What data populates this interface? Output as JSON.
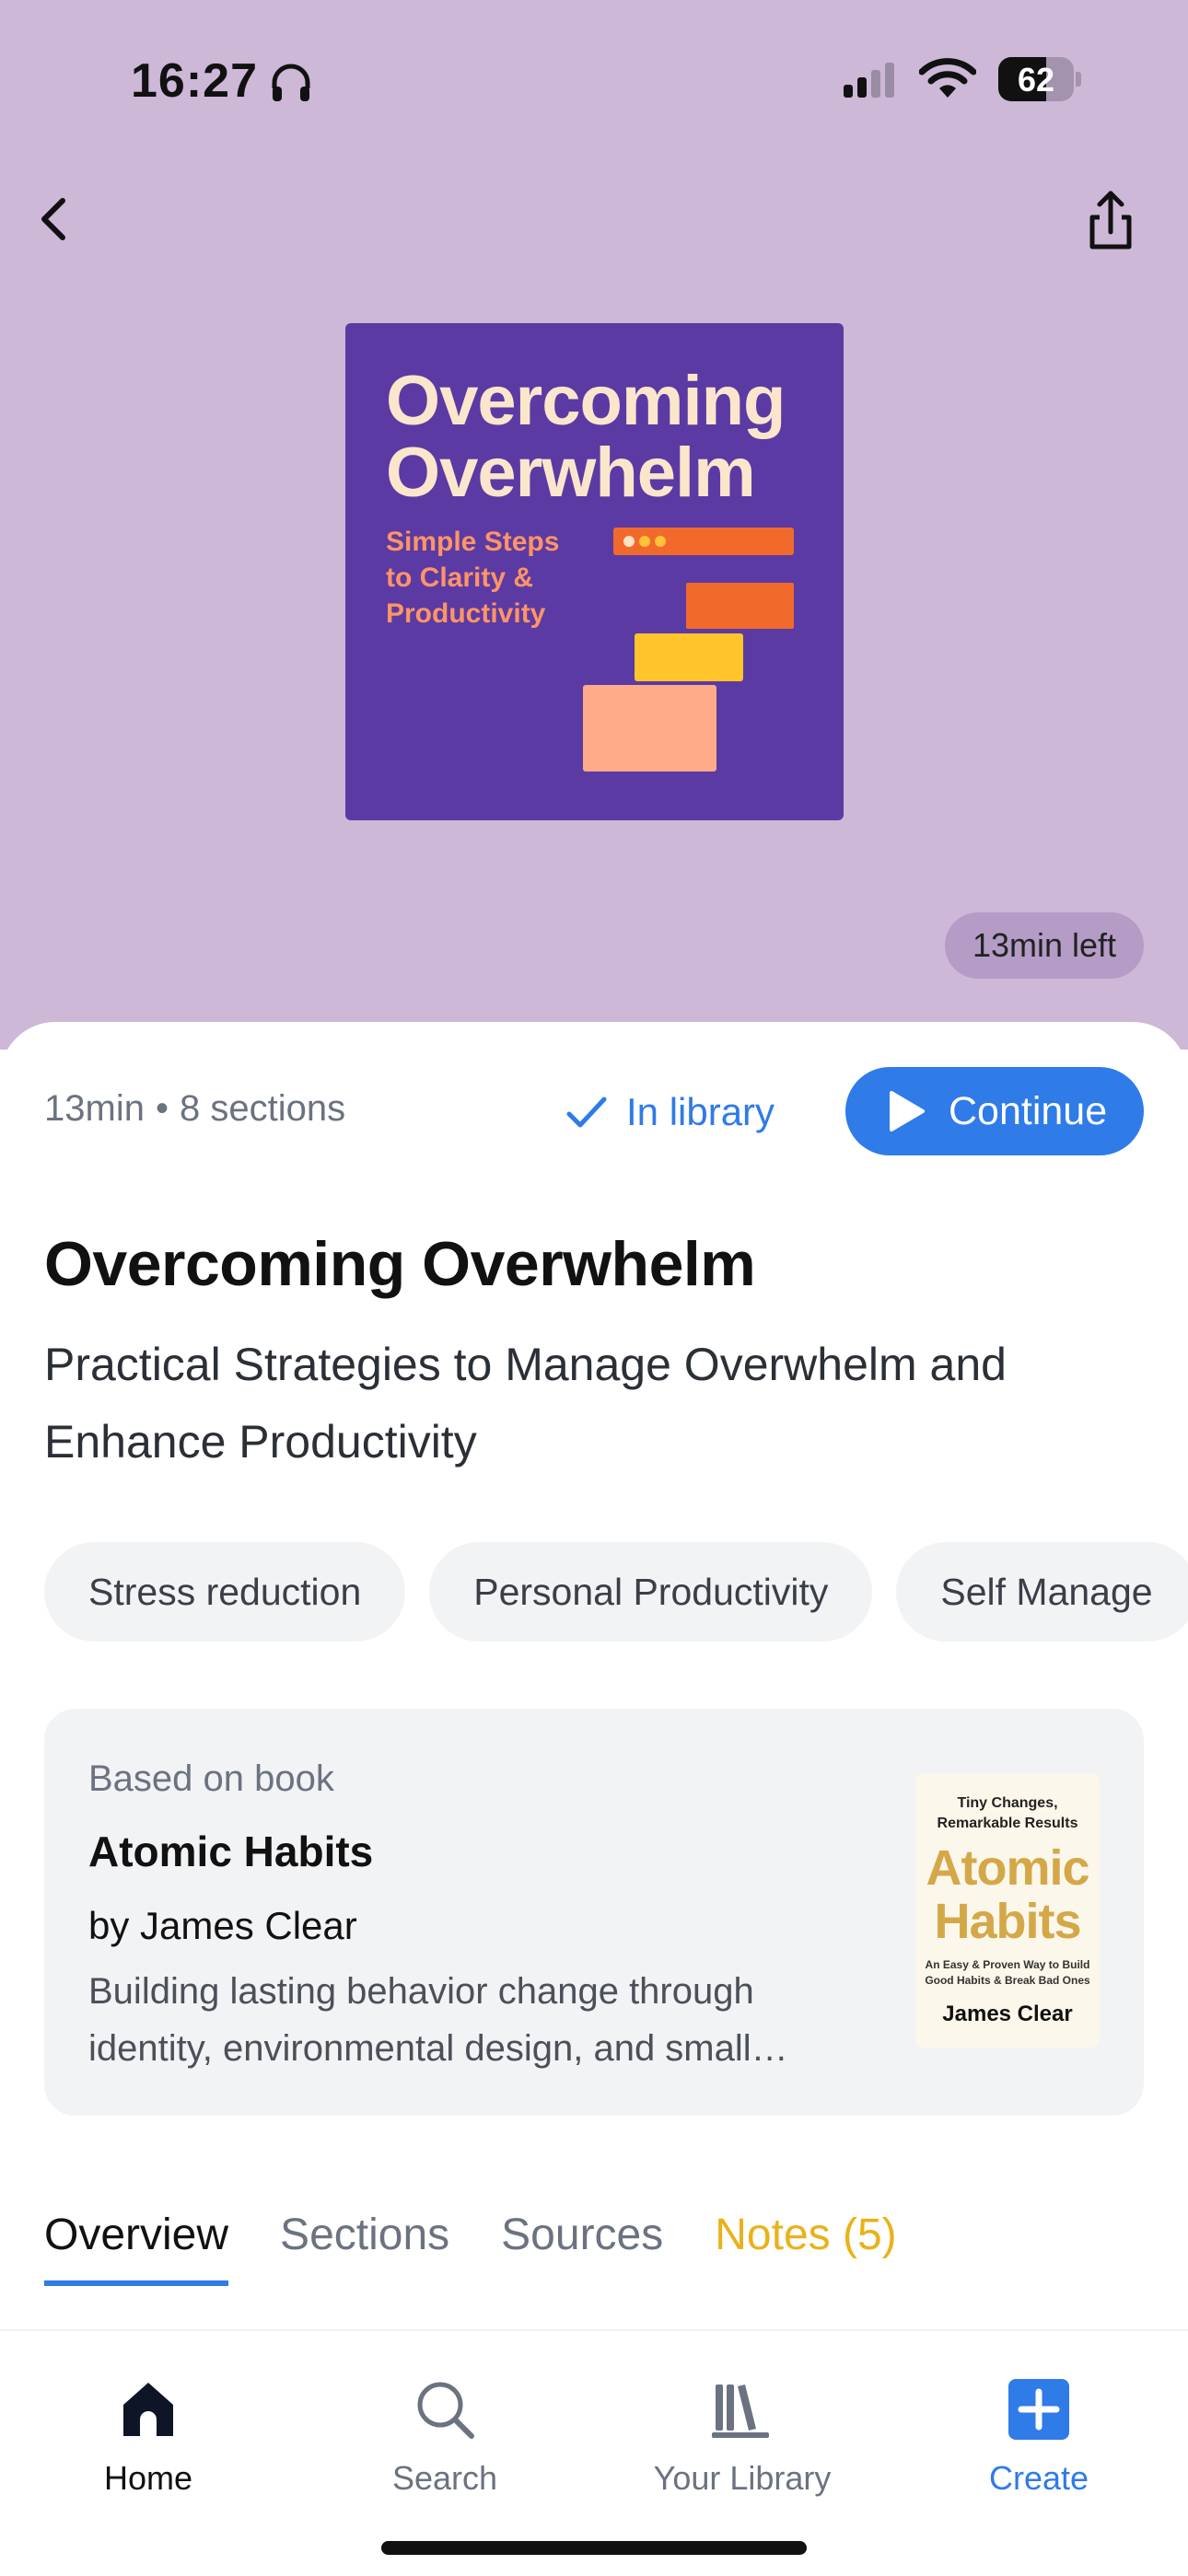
{
  "status_bar": {
    "time": "16:27",
    "battery": "62"
  },
  "cover": {
    "title": "Overcoming Overwhelm",
    "subtitle": "Simple Steps to Clarity & Productivity"
  },
  "time_left": "13min left",
  "meta": {
    "duration": "13min",
    "sections": "8 sections"
  },
  "in_library_label": "In library",
  "continue_label": "Continue",
  "title": "Overcoming Overwhelm",
  "subtitle": "Practical Strategies to Manage Overwhelm and Enhance Productivity",
  "tags": [
    "Stress reduction",
    "Personal Productivity",
    "Self Manage"
  ],
  "book": {
    "label": "Based on book",
    "title": "Atomic Habits",
    "author": "by James Clear",
    "description": "Building lasting behavior change through identity, environmental design, and small…",
    "cover": {
      "tagline": "Tiny Changes, Remarkable Results",
      "title": "Atomic Habits",
      "small": "An Easy & Proven Way to Build Good Habits & Break Bad Ones",
      "author": "James Clear"
    }
  },
  "tabs": [
    "Overview",
    "Sections",
    "Sources",
    "Notes (5)"
  ],
  "tabbar": [
    "Home",
    "Search",
    "Your Library",
    "Create"
  ],
  "colors": {
    "accent": "#2f7be8",
    "hero_bg": "#cdb8d7",
    "cover_bg": "#5b3aa4",
    "notes": "#e9b21a"
  }
}
